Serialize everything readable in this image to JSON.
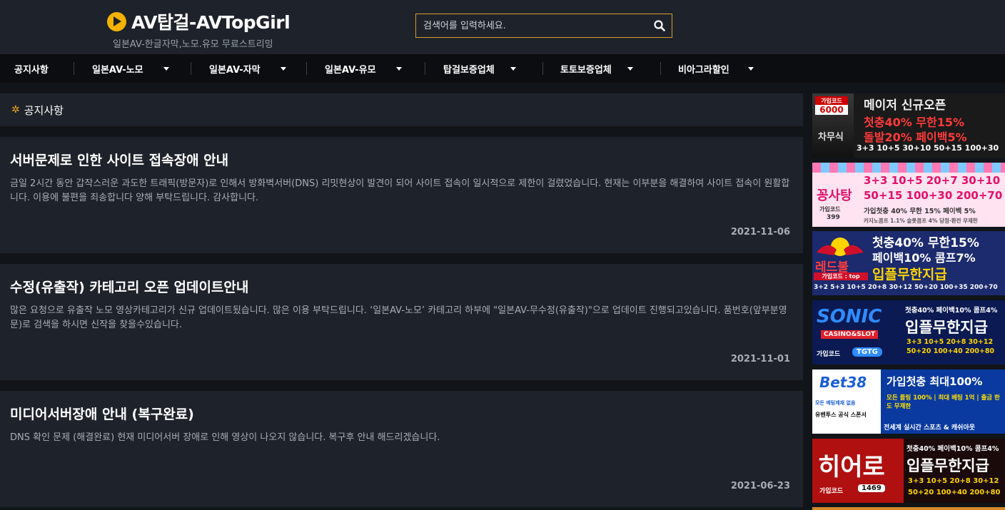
{
  "header": {
    "title": "AV탑걸-AVTopGirl",
    "subtitle": "일본AV-한글자막,노모.유모 무료스트리밍",
    "search_placeholder": "검색어를 입력하세요."
  },
  "nav": {
    "items": [
      {
        "label": "공지사항",
        "has_dropdown": false
      },
      {
        "label": "일본AV-노모",
        "has_dropdown": true
      },
      {
        "label": "일본AV-자막",
        "has_dropdown": true
      },
      {
        "label": "일본AV-유모",
        "has_dropdown": true
      },
      {
        "label": "탑걸보증업체",
        "has_dropdown": true
      },
      {
        "label": "토토보증업체",
        "has_dropdown": true
      },
      {
        "label": "비아그라할인",
        "has_dropdown": true
      }
    ]
  },
  "section": {
    "title": "공지사항"
  },
  "posts": [
    {
      "title": "서버문제로 인한 사이트 접속장애 안내",
      "body": "금일 2시간 동안 갑작스러운 과도한 트래픽(방문자)로 인해서 방화벽서버(DNS) 리밋현상이 발견이 되어 사이트 접속이 일시적으로 제한이 걸렸었습니다. 현재는 이부분을 해결하여 사이트 접속이 원활합니다. 이용에 불편을 죄송합니다 양해 부탁드립니다. 감사합니다.",
      "date": "2021-11-06"
    },
    {
      "title": "수정(유출작) 카테고리 오픈 업데이트안내",
      "body": "많은 요청으로 유출작 노모 영상카테고리가 신규 업데이트됬습니다. 많은 이용 부탁드립니다. ‘일본AV-노모’ 카테고리 하부에 \"일본AV-무수정(유출작)\"으로 업데이트 진행되고있습니다. 품번호(앞부분영문)로 검색을 하시면 신작을 찾을수있습니다.",
      "date": "2021-11-01"
    },
    {
      "title": "미디어서버장애 안내 (복구완료)",
      "body": "DNS 확인 문제 (해결완료) 현재 미디어서버 장애로 인해 영상이 나오지 않습니다. 복구후 안내 해드리겠습니다.",
      "date": "2021-06-23"
    }
  ],
  "banners": [
    {
      "name": "차무식",
      "code_label": "가입코드",
      "code": "6000",
      "headline": "메이저 신규오픈",
      "line1": "첫충40% 무한15%",
      "line2": "돌발20% 페이백5%",
      "line3": "3+3 10+5 30+10 50+15 100+30",
      "bg": "#1a1a1a",
      "accent": "#ff2a2a"
    },
    {
      "name": "꽁사탕",
      "code_label": "가입코드",
      "code": "399",
      "headline": "3+3 10+5 20+7 30+10",
      "line1": "50+15 100+30 200+70",
      "line2": "가입첫충 40% 무한 15% 페이백 5%",
      "line3": "카지노콤프 1.1% 슬롯콤프 4% 당첨·환전 무제한",
      "bg": "#ffe3f0",
      "accent": "#e0106a"
    },
    {
      "name": "레드불",
      "code_label": "가입코드 : top",
      "code": "",
      "headline": "첫충40% 무한15%",
      "line1": "페이백10% 콤프7%",
      "line2": "입플무한지급",
      "line3": "3+2 5+3 10+5 20+8 30+12 50+20 100+35 200+70",
      "bg": "#1c2a6e",
      "accent": "#ffd400"
    },
    {
      "name": "SONIC",
      "code_label": "가입코드",
      "code": "TGTG",
      "headline": "첫충40% 페이백10% 콤프4%",
      "line1": "CASINO&SLOT",
      "line2": "입플무한지급",
      "line3": "3+3 10+5 20+8 30+12 50+20 100+40 200+80",
      "bg": "#0b1a52",
      "accent": "#2f8cff"
    },
    {
      "name": "Bet38",
      "code_label": "유벤투스 공식 스폰서",
      "code": "",
      "headline": "가입첫충 최대100%",
      "line1": "모든 롤링 100% | 최대 베팅 1억 | 출금 한도 무제한",
      "line2": "모든 베팅제재 없음",
      "line3": "전세계 실시간 스포츠 & 캐쉬아웃",
      "bg": "#0a3aa0",
      "accent": "#ffe000"
    },
    {
      "name": "히어로",
      "code_label": "가입코드",
      "code": "1469",
      "headline": "첫충40% 페이백10% 콤프4%",
      "line1": "입플무한지급",
      "line2": "3+3 10+5 20+8 30+12",
      "line3": "50+20 100+40 200+80",
      "bg": "#1a0a0a",
      "accent": "#ff2222"
    }
  ]
}
